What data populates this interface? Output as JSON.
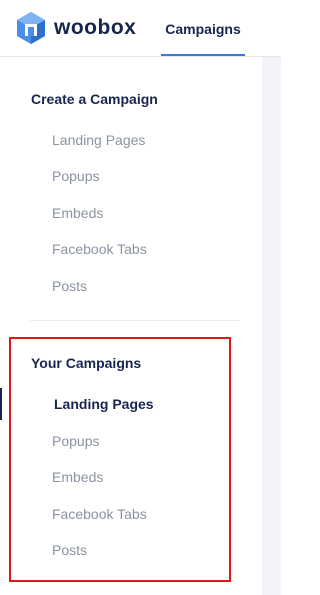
{
  "header": {
    "logo_text": "woobox",
    "nav_tab": "Campaigns",
    "accent_color": "#3a7bd5",
    "logo_icon": "woobox-hexagon-icon"
  },
  "sidebar": {
    "create_section": {
      "title": "Create a Campaign",
      "items": [
        "Landing Pages",
        "Popups",
        "Embeds",
        "Facebook Tabs",
        "Posts"
      ]
    },
    "your_section": {
      "title": "Your Campaigns",
      "items": [
        "Landing Pages",
        "Popups",
        "Embeds",
        "Facebook Tabs",
        "Posts"
      ],
      "active_item": "Landing Pages"
    },
    "highlight_color": "#e0141b"
  }
}
